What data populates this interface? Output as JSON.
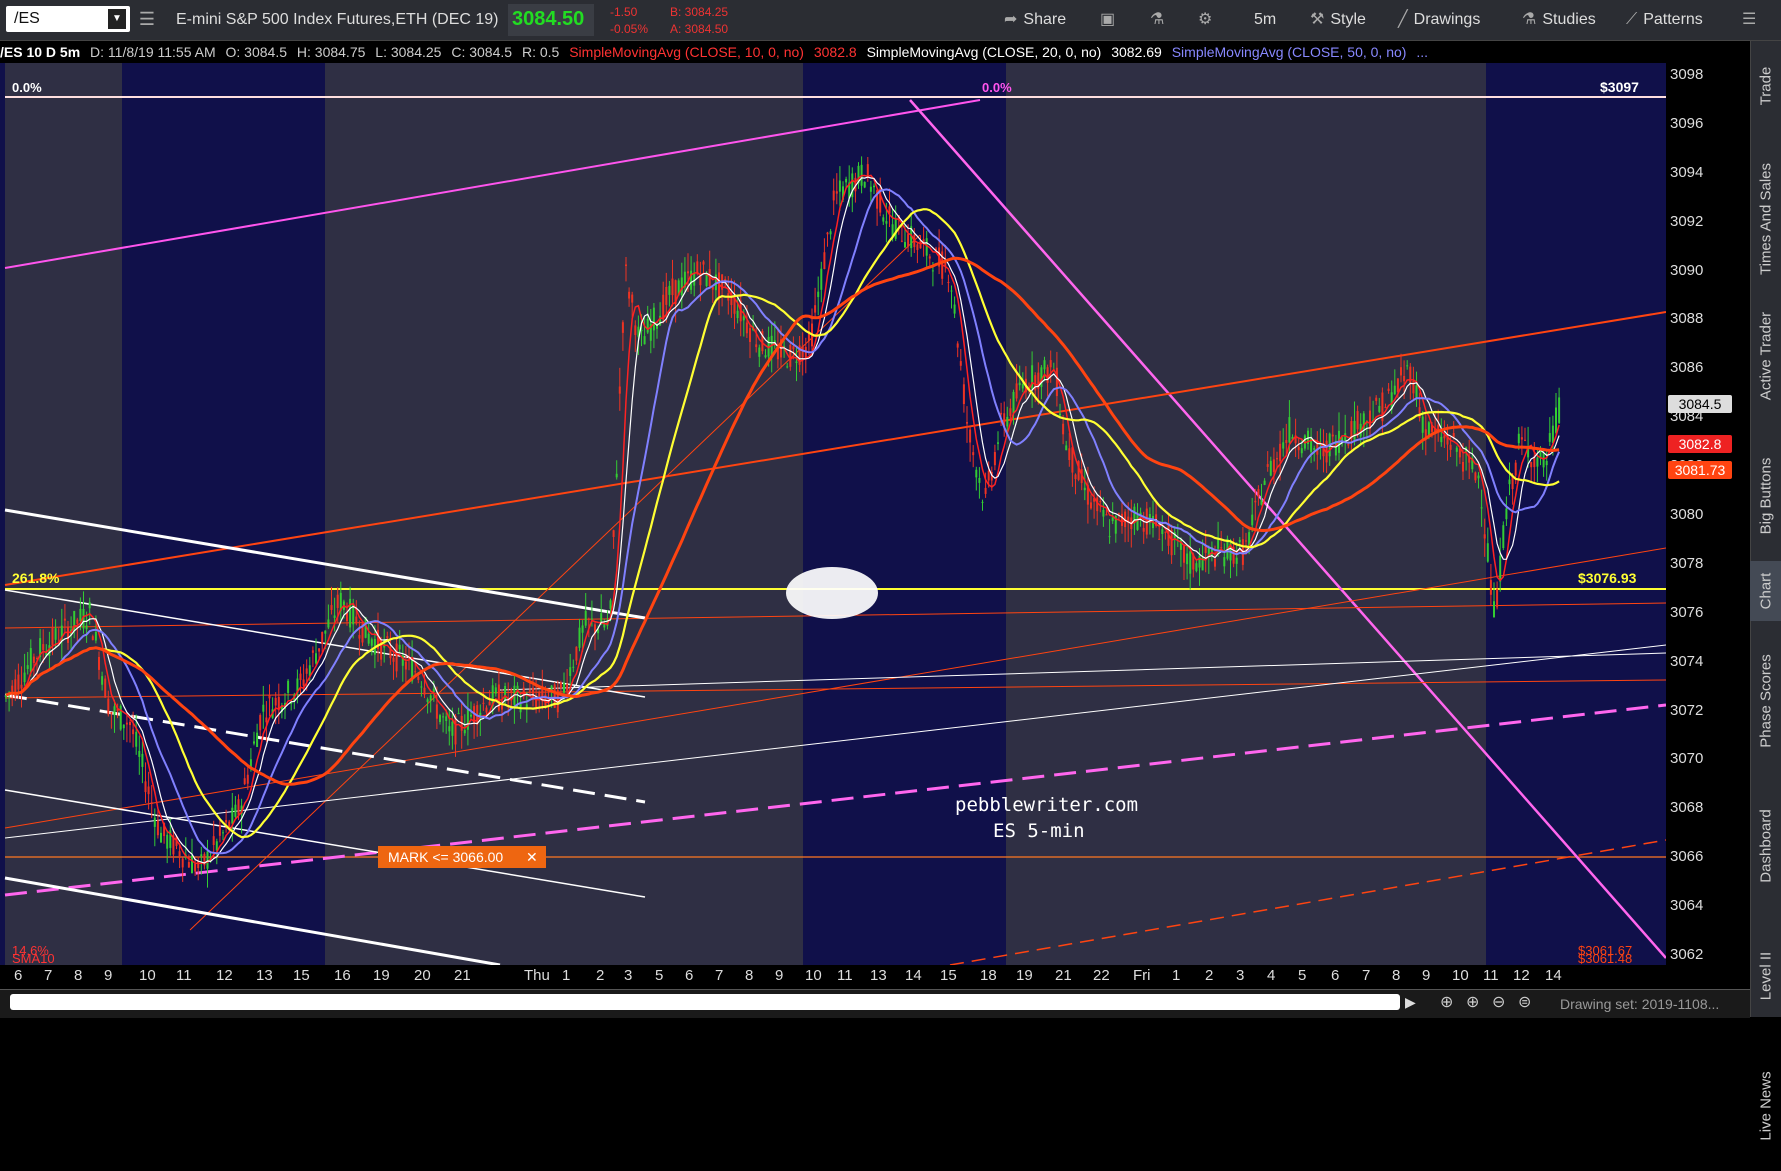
{
  "toolbar": {
    "symbol": "/ES",
    "description": "E-mini S&P 500 Index Futures,ETH (DEC 19)",
    "last_price": "3084.50",
    "change": "-1.50",
    "change_pct": "-0.05%",
    "bid": "B: 3084.25",
    "ask": "A: 3084.50",
    "share_label": "Share",
    "timeframe_label": "5m",
    "style_label": "Style",
    "drawings_label": "Drawings",
    "studies_label": "Studies",
    "patterns_label": "Patterns"
  },
  "infobar": {
    "symbol_period": "/ES 10 D 5m",
    "datetime": "D: 11/8/19 11:55 AM",
    "open": "O: 3084.5",
    "high": "H: 3084.75",
    "low": "L: 3084.25",
    "close": "C: 3084.5",
    "range": "R: 0.5",
    "sma10_label": "SimpleMovingAvg (CLOSE, 10, 0, no)",
    "sma10_value": "3082.8",
    "sma20_label": "SimpleMovingAvg (CLOSE, 20, 0, no)",
    "sma20_value": "3082.69",
    "sma50_label": "SimpleMovingAvg (CLOSE, 50, 0, no)",
    "sma50_value": "..."
  },
  "colors": {
    "sma10": "#ff2222",
    "sma20": "#ffffff",
    "sma50": "#8080ff",
    "sma_yellow": "#ffff33",
    "sma_orange": "#ff4411",
    "magenta": "#ff66ee",
    "background_light": "#2f2f44",
    "background_dark": "#10104a"
  },
  "chart_data": {
    "type": "candlestick",
    "ylim": [
      3062,
      3098
    ],
    "y_ticks": [
      "3098",
      "3096",
      "3094",
      "3092",
      "3090",
      "3088",
      "3086",
      "3084",
      "3082",
      "3080",
      "3078",
      "3076",
      "3074",
      "3072",
      "3070",
      "3068",
      "3066",
      "3064",
      "3062"
    ],
    "x_ticks": [
      "6",
      "7",
      "8",
      "9",
      "10",
      "11",
      "12",
      "13",
      "15",
      "16",
      "19",
      "20",
      "21",
      "Thu",
      "1",
      "2",
      "3",
      "5",
      "6",
      "7",
      "8",
      "9",
      "10",
      "11",
      "13",
      "14",
      "15",
      "18",
      "19",
      "21",
      "22",
      "Fri",
      "1",
      "2",
      "3",
      "4",
      "5",
      "6",
      "7",
      "8",
      "9",
      "10",
      "11",
      "12",
      "14"
    ],
    "price_badges": [
      {
        "label": "3084.5",
        "value": 3084.5
      },
      {
        "label": "3082.8",
        "value": 3082.8
      },
      {
        "label": "3081.73",
        "value": 3081.73
      }
    ],
    "annotations": {
      "fib_top_left": "0.0%",
      "fib_top_mid": "0.0%",
      "level_3097": "$3097",
      "fib_2618": "261.8%",
      "level_3076": "$3076.93",
      "mark_label": "MARK  <= 3066.00",
      "watermark_1": "pebblewriter.com",
      "watermark_2": "ES 5-min",
      "bottom_left_1": "14.6%",
      "bottom_left_2": "SMA10",
      "bottom_right_1": "$3061.67",
      "bottom_right_2": "$3061.48"
    }
  },
  "right_tabs": [
    "Trade",
    "Times And Sales",
    "Active Trader",
    "Big Buttons",
    "Chart",
    "Phase Scores",
    "Dashboard",
    "Level II",
    "Live News"
  ],
  "bottom": {
    "drawing_set": "Drawing set: 2019-1108..."
  }
}
